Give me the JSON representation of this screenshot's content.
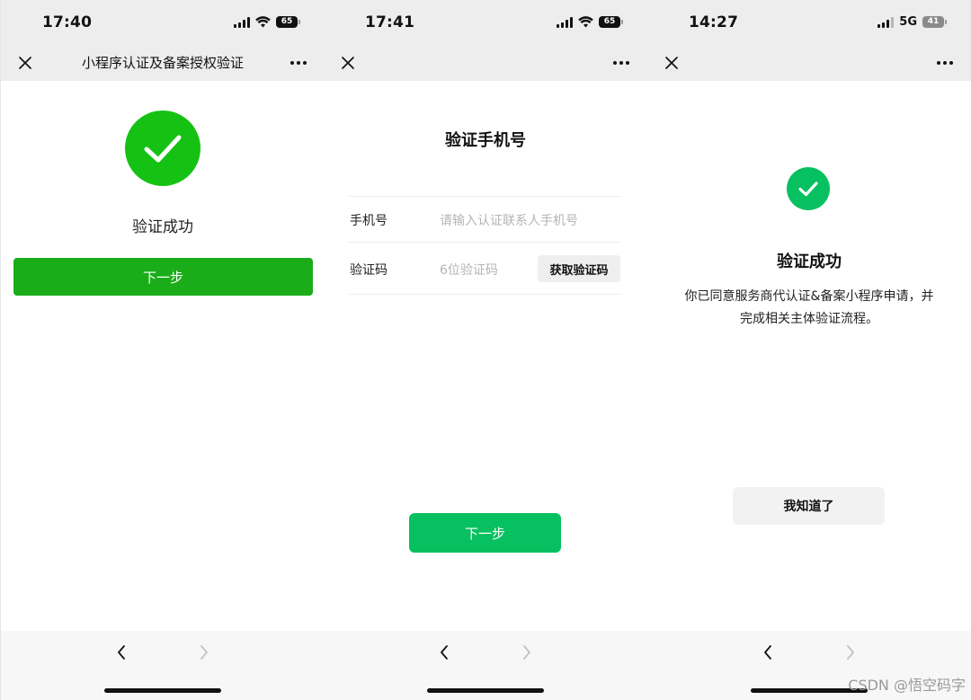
{
  "colors": {
    "bar_bg": "#ededed",
    "success_green": "#15c214",
    "primary_green": "#1aad19",
    "wechat_green": "#07c160",
    "placeholder_gray": "#b5b5b5",
    "button_gray": "#f2f2f2"
  },
  "screens": [
    {
      "status": {
        "time": "17:40",
        "network": "wifi",
        "battery": "65"
      },
      "navbar": {
        "close_icon": "close-icon",
        "title": "小程序认证及备案授权验证",
        "more_icon": "more-icon"
      },
      "content": {
        "icon": "success-check-icon",
        "title": "验证成功",
        "next_button": "下一步"
      },
      "bottom": {
        "back_icon": "chevron-left-icon",
        "forward_icon": "chevron-right-icon"
      }
    },
    {
      "status": {
        "time": "17:41",
        "network": "wifi",
        "battery": "65"
      },
      "navbar": {
        "close_icon": "close-icon",
        "title": "",
        "more_icon": "more-icon"
      },
      "content": {
        "title": "验证手机号",
        "phone_label": "手机号",
        "phone_placeholder": "请输入认证联系人手机号",
        "code_label": "验证码",
        "code_placeholder": "6位验证码",
        "get_code_button": "获取验证码",
        "next_button": "下一步"
      },
      "bottom": {
        "back_icon": "chevron-left-icon",
        "forward_icon": "chevron-right-icon"
      }
    },
    {
      "status": {
        "time": "14:27",
        "network": "5G",
        "battery": "41"
      },
      "navbar": {
        "close_icon": "close-icon",
        "title": "",
        "more_icon": "more-icon"
      },
      "content": {
        "icon": "success-check-icon",
        "title": "验证成功",
        "description_line1": "你已同意服务商代认证&备案小程序申请，并",
        "description_line2": "完成相关主体验证流程。",
        "ok_button": "我知道了"
      },
      "bottom": {
        "back_icon": "chevron-left-icon",
        "forward_icon": "chevron-right-icon"
      }
    }
  ],
  "watermark": "CSDN @悟空码字"
}
